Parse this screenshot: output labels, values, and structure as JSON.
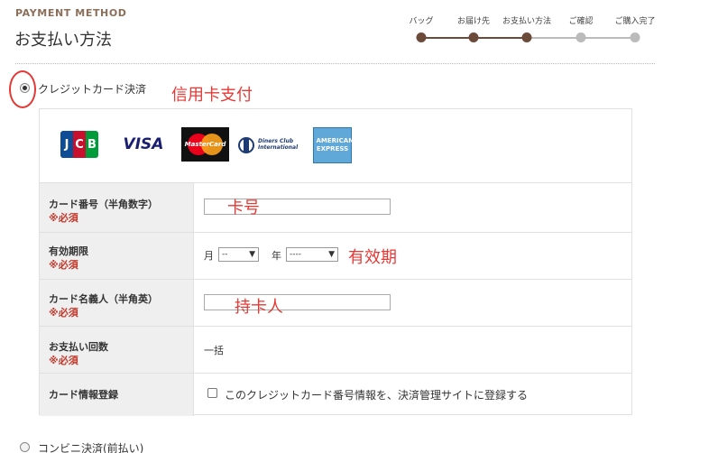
{
  "header": {
    "eyebrow": "PAYMENT METHOD",
    "title": "お支払い方法"
  },
  "steps": [
    {
      "label": "バッグ",
      "status": "done"
    },
    {
      "label": "お届け先",
      "status": "done"
    },
    {
      "label": "お支払い方法",
      "status": "current"
    },
    {
      "label": "ご確認",
      "status": "todo"
    },
    {
      "label": "ご購入完了",
      "status": "todo"
    }
  ],
  "payment": {
    "credit_label": "クレジットカード決済",
    "convenience_label": "コンビニ決済(前払い)",
    "cards": [
      "JCB",
      "VISA",
      "MasterCard",
      "Diners Club International",
      "AMERICAN EXPRESS"
    ]
  },
  "annotations": {
    "credit": "信用卡支付",
    "card_number": "卡号",
    "expiry": "有效期",
    "holder": "持卡人"
  },
  "form": {
    "card_number": {
      "label": "カード番号（半角数字）",
      "required": "※必須",
      "value": ""
    },
    "expiry": {
      "label": "有効期限",
      "required": "※必須",
      "month_label": "月",
      "month_value": "--",
      "year_label": "年",
      "year_value": "----"
    },
    "holder": {
      "label": "カード名義人（半角英）",
      "required": "※必須",
      "value": ""
    },
    "installments": {
      "label": "お支払い回数",
      "required": "※必須",
      "value": "一括"
    },
    "register": {
      "label": "カード情報登録",
      "checkbox_label": "このクレジットカード番号情報を、決済管理サイトに登録する"
    }
  },
  "colors": {
    "brand": "#8b6f5a",
    "progress_done": "#6b4a3a",
    "progress_todo": "#bbbbbb",
    "annotation": "#e53935",
    "required": "#c0392b"
  }
}
